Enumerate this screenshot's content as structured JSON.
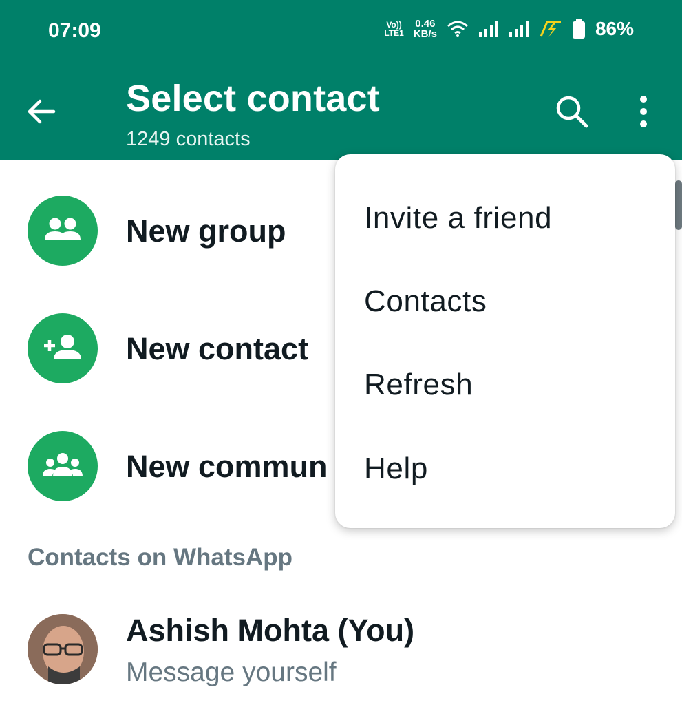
{
  "colors": {
    "header": "#008069",
    "accent": "#1DAA61",
    "text": "#111b21",
    "secondary": "#667781"
  },
  "status_bar": {
    "time": "07:09",
    "volte_top": "Vo))",
    "volte_bottom": "LTE1",
    "speed_value": "0.46",
    "speed_unit": "KB/s",
    "battery": "86%"
  },
  "header": {
    "title": "Select contact",
    "subtitle": "1249 contacts"
  },
  "actions": [
    {
      "label": "New group",
      "icon": "group-icon"
    },
    {
      "label": "New contact",
      "icon": "add-person-icon"
    },
    {
      "label": "New commun",
      "icon": "community-icon"
    }
  ],
  "section_title": "Contacts on WhatsApp",
  "contact": {
    "name": "Ashish Mohta (You)",
    "status": "Message yourself"
  },
  "menu": {
    "items": [
      "Invite a friend",
      "Contacts",
      "Refresh",
      "Help"
    ]
  }
}
